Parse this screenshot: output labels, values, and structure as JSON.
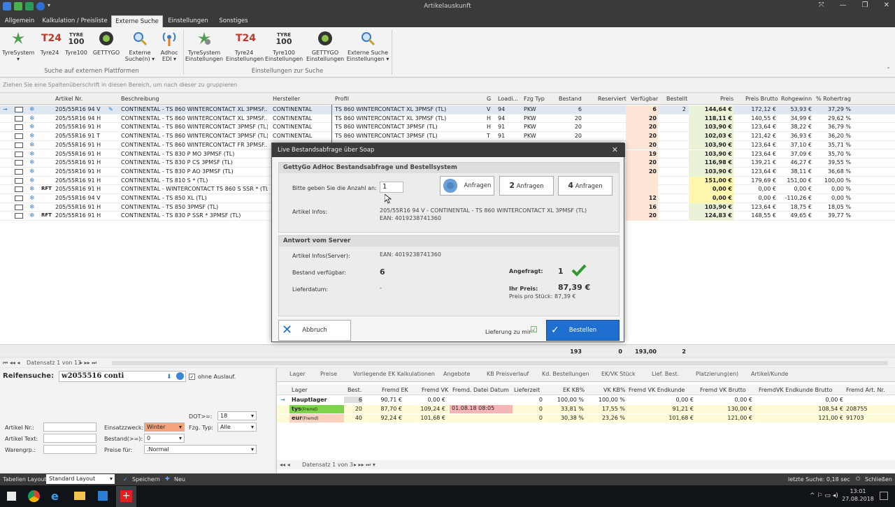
{
  "window": {
    "title": "Artikelauskunft"
  },
  "menu_tabs": [
    "Allgemein",
    "Kalkulation / Preisliste",
    "Externe Suche",
    "Einstellungen",
    "Sonstiges"
  ],
  "ribbon": {
    "search_buttons": [
      {
        "label": "TyreSystem",
        "sub": "▾"
      },
      {
        "label": "Tyre24",
        "sub": ""
      },
      {
        "label": "Tyre100",
        "sub": ""
      },
      {
        "label": "GETTYGO",
        "sub": ""
      },
      {
        "label": "Externe",
        "sub": "Suche(n) ▾"
      },
      {
        "label": "Adhoc",
        "sub": "EDI ▾"
      }
    ],
    "settings_buttons": [
      {
        "label": "TyreSystem",
        "sub": "Einstellungen"
      },
      {
        "label": "Tyre24",
        "sub": "Einstellungen"
      },
      {
        "label": "Tyre100",
        "sub": "Einstellungen"
      },
      {
        "label": "GETTYGO",
        "sub": "Einstellungen"
      },
      {
        "label": "Externe Suche",
        "sub": "Einstellungen ▾"
      }
    ],
    "group1": "Suche auf externen Plattformen",
    "group2": "Einstellungen zur Suche",
    "tyre_text": "TYRE",
    "tyre_num": "100",
    "t24": "T24"
  },
  "group_hint": "Ziehen Sie eine Spaltenüberschrift in diesen Bereich, um nach dieser zu gruppieren",
  "grid": {
    "headers": [
      "Artikel Nr.",
      "Beschreibung",
      "Hersteller",
      "Profil",
      "G",
      "Loadi...",
      "Fzg Typ",
      "Bestand",
      "Reserviert",
      "Verfügbar",
      "Bestellt",
      "Preis",
      "Preis Brutto",
      "Rohgewinn",
      "% Rohertrag"
    ],
    "rows": [
      {
        "tag": "",
        "art": "205/55R16 94 V",
        "desc": "CONTINENTAL - TS 860 WINTERCONTACT XL 3PMSF...",
        "her": "CONTINENTAL",
        "prof": "TS 860 WINTERCONTACT XL 3PMSF (TL)",
        "g": "V",
        "load": "94",
        "fzg": "PKW",
        "best": "6",
        "verf": "6",
        "bestellt": "2",
        "preis": "144,64 €",
        "brutto": "172,12 €",
        "roh": "53,93 €",
        "proz": "37,29 %"
      },
      {
        "tag": "",
        "art": "205/55R16 94 H",
        "desc": "CONTINENTAL - TS 860 WINTERCONTACT XL 3PMSF...",
        "her": "CONTINENTAL",
        "prof": "TS 860 WINTERCONTACT XL 3PMSF (TL)",
        "g": "H",
        "load": "94",
        "fzg": "PKW",
        "best": "20",
        "verf": "20",
        "bestellt": "",
        "preis": "118,11 €",
        "brutto": "140,55 €",
        "roh": "34,99 €",
        "proz": "29,62 %"
      },
      {
        "tag": "",
        "art": "205/55R16 91 H",
        "desc": "CONTINENTAL - TS 860 WINTERCONTACT 3PMSF (TL)",
        "her": "CONTINENTAL",
        "prof": "TS 860 WINTERCONTACT 3PMSF (TL)",
        "g": "H",
        "load": "91",
        "fzg": "PKW",
        "best": "20",
        "verf": "20",
        "bestellt": "",
        "preis": "103,90 €",
        "brutto": "123,64 €",
        "roh": "38,22 €",
        "proz": "36,79 %"
      },
      {
        "tag": "",
        "art": "205/55R16 91 T",
        "desc": "CONTINENTAL - TS 860 WINTERCONTACT 3PMSF (TL)",
        "her": "CONTINENTAL",
        "prof": "TS 860 WINTERCONTACT 3PMSF (TL)",
        "g": "T",
        "load": "91",
        "fzg": "PKW",
        "best": "20",
        "verf": "20",
        "bestellt": "",
        "preis": "102,03 €",
        "brutto": "121,42 €",
        "roh": "36,93 €",
        "proz": "36,20 %"
      },
      {
        "tag": "",
        "art": "205/55R16 91 H",
        "desc": "CONTINENTAL - TS 860 WINTERCONTACT FR 3PMSF...",
        "her": "",
        "prof": "",
        "g": "",
        "load": "",
        "fzg": "",
        "best": "",
        "verf": "20",
        "bestellt": "",
        "preis": "103,90 €",
        "brutto": "123,64 €",
        "roh": "37,10 €",
        "proz": "35,71 %"
      },
      {
        "tag": "",
        "art": "205/55R16 91 H",
        "desc": "CONTINENTAL - TS 830 P MO 3PMSF (TL)",
        "her": "",
        "prof": "",
        "g": "",
        "load": "",
        "fzg": "",
        "best": "",
        "verf": "19",
        "bestellt": "",
        "preis": "103,90 €",
        "brutto": "123,64 €",
        "roh": "37,09 €",
        "proz": "35,70 %"
      },
      {
        "tag": "",
        "art": "205/55R16 91 H",
        "desc": "CONTINENTAL - TS 830 P CS 3PMSF (TL)",
        "her": "",
        "prof": "",
        "g": "",
        "load": "",
        "fzg": "",
        "best": "",
        "verf": "20",
        "bestellt": "",
        "preis": "116,98 €",
        "brutto": "139,21 €",
        "roh": "46,27 €",
        "proz": "39,55 %"
      },
      {
        "tag": "",
        "art": "205/55R16 91 H",
        "desc": "CONTINENTAL - TS 830 P AO 3PMSF (TL)",
        "her": "",
        "prof": "",
        "g": "",
        "load": "",
        "fzg": "",
        "best": "",
        "verf": "20",
        "bestellt": "",
        "preis": "103,90 €",
        "brutto": "123,64 €",
        "roh": "38,11 €",
        "proz": "36,68 %"
      },
      {
        "tag": "",
        "art": "205/55R16 91 H",
        "desc": "CONTINENTAL - TS 810 S * (TL)",
        "her": "",
        "prof": "",
        "g": "",
        "load": "",
        "fzg": "",
        "best": "",
        "verf": "",
        "bestellt": "",
        "preis": "151,00 €",
        "brutto": "179,69 €",
        "roh": "151,00 €",
        "proz": "100,00 %"
      },
      {
        "tag": "RFT",
        "art": "205/55R16 91 H",
        "desc": "CONTINENTAL - WINTERCONTACT TS 860 S SSR * (TL)",
        "her": "",
        "prof": "",
        "g": "",
        "load": "",
        "fzg": "",
        "best": "",
        "verf": "",
        "bestellt": "",
        "preis": "0,00 €",
        "brutto": "0,00 €",
        "roh": "0,00 €",
        "proz": "0,00 %"
      },
      {
        "tag": "",
        "art": "205/55R16 94 V",
        "desc": "CONTINENTAL - TS 850 XL (TL)",
        "her": "",
        "prof": "",
        "g": "",
        "load": "",
        "fzg": "",
        "best": "",
        "verf": "12",
        "bestellt": "",
        "preis": "0,00 €",
        "brutto": "0,00 €",
        "roh": "-110,26 €",
        "proz": "0,00 %"
      },
      {
        "tag": "",
        "art": "205/55R16 91 H",
        "desc": "CONTINENTAL - TS 850 3PMSF (TL)",
        "her": "",
        "prof": "",
        "g": "",
        "load": "",
        "fzg": "",
        "best": "",
        "verf": "16",
        "bestellt": "",
        "preis": "103,90 €",
        "brutto": "123,64 €",
        "roh": "18,75 €",
        "proz": "18,05 %"
      },
      {
        "tag": "RFT",
        "art": "205/55R16 91 H",
        "desc": "CONTINENTAL - TS 830 P SSR * 3PMSF (TL)",
        "her": "",
        "prof": "",
        "g": "",
        "load": "",
        "fzg": "",
        "best": "",
        "verf": "20",
        "bestellt": "",
        "preis": "124,83 €",
        "brutto": "148,55 €",
        "roh": "49,65 €",
        "proz": "39,77 %"
      }
    ],
    "sum": {
      "bestand": "193",
      "reserviert": "0",
      "verfuegbar": "193,00",
      "bestellt": "2"
    },
    "nav": "Datensatz 1 von 13"
  },
  "search": {
    "label": "Reifensuche:",
    "value": "w2055516 conti",
    "ohne_auslauf": "ohne Auslauf.",
    "dot_label": "DOT>=:",
    "dot_value": "18",
    "artikel_nr": "Artikel Nr.:",
    "artikel_text": "Artikel Text:",
    "warengrp": "Warengrp.:",
    "einsatz_label": "Einsatzzweck:",
    "einsatz_value": "Winter",
    "fzg_label": "Fzg. Typ:",
    "fzg_value": "Alle",
    "bestand_label": "Bestand(>=):",
    "bestand_value": "0",
    "preise_label": "Preise für:",
    "preise_value": ".Normal"
  },
  "detail": {
    "tabs": [
      "Lager",
      "Preise",
      "Vorliegende EK Kalkulationen",
      "Angebote",
      "KB Preisverlauf",
      "Kd. Bestellungen",
      "EK/VK Stück",
      "Lief. Best.",
      "Platzierung(en)",
      "Artikel/Kunde"
    ],
    "headers": [
      "Lager",
      "Best.",
      "Fremd EK",
      "Fremd VK",
      "Fremd. Datei Datum",
      "Lieferzeit",
      "EK KB%",
      "VK KB%",
      "Fremd VK Endkunde",
      "Fremd VK Brutto",
      "FremdVK Endkunde Brutto",
      "Fremd Art. Nr."
    ],
    "rows": [
      {
        "lager": "Hauptlager",
        "sub": "",
        "best": "6",
        "ek": "90,71 €",
        "vk": "0,00 €",
        "datum": "",
        "lief": "0",
        "ekkb": "100,00 %",
        "vkkb": "100,00 %",
        "endk": "0,00 €",
        "brutto": "0,00 €",
        "endkb": "0,00 €",
        "artnr": ""
      },
      {
        "lager": "tys",
        "sub": "(Fremd)",
        "best": "20",
        "ek": "87,70 €",
        "vk": "109,24 €",
        "datum": "01.08.18 08:05",
        "lief": "0",
        "ekkb": "33,81 %",
        "vkkb": "17,55 %",
        "endk": "91,21 €",
        "brutto": "130,00 €",
        "endkb": "108,54 €",
        "artnr": "208755"
      },
      {
        "lager": "eur",
        "sub": "(Fremd)",
        "best": "40",
        "ek": "92,24 €",
        "vk": "101,68 €",
        "datum": "",
        "lief": "0",
        "ekkb": "30,38 %",
        "vkkb": "23,26 %",
        "endk": "101,68 €",
        "brutto": "121,00 €",
        "endkb": "121,00 €",
        "artnr": "91703"
      }
    ],
    "nav": "Datensatz 1 von 3"
  },
  "dialog": {
    "title": "Live Bestandsabfrage über Soap",
    "section1": "GettyGo AdHoc Bestandsabfrage und Bestellsystem",
    "anzahl_label": "Bitte geben Sie die Anzahl an:",
    "anzahl_value": "1",
    "btn_anfragen": "Anfragen",
    "btn_2": "2",
    "btn_2_label": "Anfragen",
    "btn_4": "4",
    "btn_4_label": "Anfragen",
    "info_label": "Artikel Infos:",
    "info_line1": "205/55R16 94 V - CONTINENTAL - TS 860 WINTERCONTACT XL 3PMSF (TL)",
    "info_line2": "EAN: 4019238741360",
    "section2": "Antwort vom Server",
    "srv_info_label": "Artikel Infos(Server):",
    "srv_info_value": "EAN: 4019238741360",
    "bestand_label": "Bestand verfügbar:",
    "bestand_value": "6",
    "liefer_label": "Lieferdatum:",
    "liefer_value": "-",
    "angefragt_label": "Angefragt:",
    "angefragt_value": "1",
    "preis_label": "Ihr Preis:",
    "preis_value": "87,39 €",
    "stueck_label": "Preis pro Stück:",
    "stueck_value": "87,39 €",
    "abbruch": "Abbruch",
    "lieferung": "Lieferung zu mir",
    "bestellen": "Bestellen"
  },
  "status": {
    "layout_label": "Tabellen Layout:",
    "layout_value": "Standard Layout",
    "speichern": "Speichern",
    "neu": "Neu",
    "last_search": "letzte Suche: 0,18 sec",
    "schliessen": "Schließen"
  },
  "taskbar": {
    "time": "13:01",
    "date": "27.08.2018"
  },
  "colors": {
    "accent": "#1f6fd0",
    "verfuegbar_bg": "#fde6d6",
    "preis_bg": "#eaf2d8",
    "check_green": "#2e9a2e"
  }
}
